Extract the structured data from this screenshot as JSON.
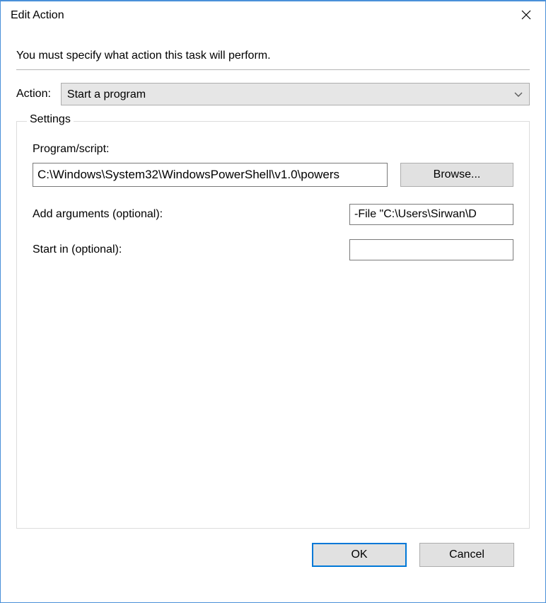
{
  "window": {
    "title": "Edit Action"
  },
  "instruction": "You must specify what action this task will perform.",
  "action": {
    "label": "Action:",
    "selected": "Start a program"
  },
  "settings": {
    "legend": "Settings",
    "program_script_label": "Program/script:",
    "program_script_value": "C:\\Windows\\System32\\WindowsPowerShell\\v1.0\\powers",
    "browse_label": "Browse...",
    "add_arguments_label": "Add arguments (optional):",
    "add_arguments_value": "-File \"C:\\Users\\Sirwan\\D",
    "start_in_label": "Start in (optional):",
    "start_in_value": ""
  },
  "buttons": {
    "ok": "OK",
    "cancel": "Cancel"
  }
}
